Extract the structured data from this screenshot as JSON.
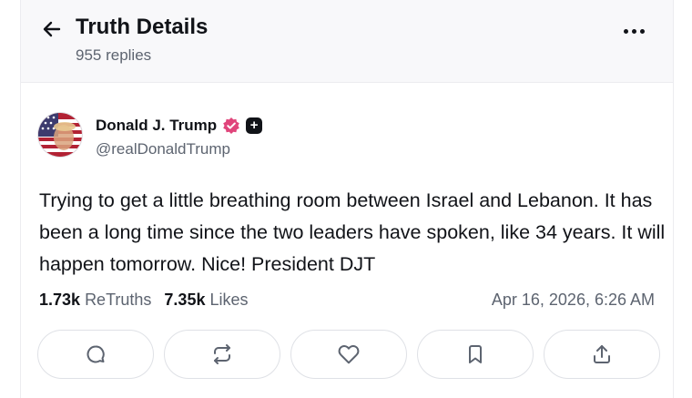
{
  "header": {
    "title": "Truth Details",
    "reply_count": "955 replies",
    "back_icon": "arrow-left-icon",
    "menu_icon": "more-horizontal-icon"
  },
  "post": {
    "author_name": "Donald J. Trump",
    "author_handle": "@realDonaldTrump",
    "verified_icon": "verified-badge-icon",
    "plus_badge": "+",
    "text": "Trying to get a little breathing room between Israel and Lebanon. It has been a long time since the two leaders have spoken, like 34 years. It will happen tomorrow. Nice! President DJT",
    "retruths_count": "1.73k",
    "retruths_label": "ReTruths",
    "likes_count": "7.35k",
    "likes_label": "Likes",
    "timestamp": "Apr 16, 2026, 6:26 AM"
  },
  "actions": [
    {
      "name": "reply",
      "icon": "comment-icon"
    },
    {
      "name": "retruth",
      "icon": "repost-icon"
    },
    {
      "name": "like",
      "icon": "heart-icon"
    },
    {
      "name": "bookmark",
      "icon": "bookmark-icon"
    },
    {
      "name": "share",
      "icon": "share-icon"
    }
  ],
  "colors": {
    "accent_pink": "#e0457b",
    "text_primary": "#111318",
    "text_secondary": "#5d6470",
    "border": "#dfe1e6"
  }
}
